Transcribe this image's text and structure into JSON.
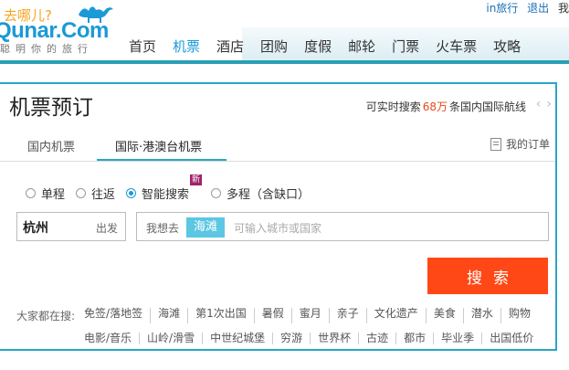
{
  "logo": {
    "tagline": "去哪儿?",
    "brand": "Qunar.Com",
    "slogan": "聪明你的旅行"
  },
  "top_links": {
    "travel": "in旅行",
    "logout": "退出",
    "more": "我"
  },
  "nav": [
    {
      "label": "首页"
    },
    {
      "label": "机票"
    },
    {
      "label": "酒店"
    },
    {
      "label": "团购"
    },
    {
      "label": "度假"
    },
    {
      "label": "邮轮"
    },
    {
      "label": "门票"
    },
    {
      "label": "火车票"
    },
    {
      "label": "攻略"
    }
  ],
  "panel": {
    "title": "机票预订",
    "realtime_prefix": "可实时搜索",
    "realtime_count": "68万",
    "realtime_suffix": "条国内国际航线",
    "tabs": [
      "国内机票",
      "国际·港澳台机票"
    ],
    "orders": "我的订单"
  },
  "trip_types": [
    {
      "label": "单程",
      "checked": false
    },
    {
      "label": "往返",
      "checked": false
    },
    {
      "label": "智能搜索",
      "checked": true,
      "badge": "新"
    },
    {
      "label": "多程（含缺口）",
      "checked": false
    }
  ],
  "from": {
    "city": "杭州",
    "label": "出发"
  },
  "to": {
    "label": "我想去",
    "tag": "海滩",
    "placeholder": "可输入城市或国家"
  },
  "search_button": "搜索",
  "hot": {
    "label": "大家都在搜:",
    "row1": [
      "免签/落地签",
      "海滩",
      "第1次出国",
      "暑假",
      "蜜月",
      "亲子",
      "文化遗产",
      "美食",
      "潜水",
      "购物"
    ],
    "row2": [
      "电影/音乐",
      "山岭/滑雪",
      "中世纪城堡",
      "穷游",
      "世界杯",
      "古迹",
      "都市",
      "毕业季",
      "出国低价"
    ]
  }
}
